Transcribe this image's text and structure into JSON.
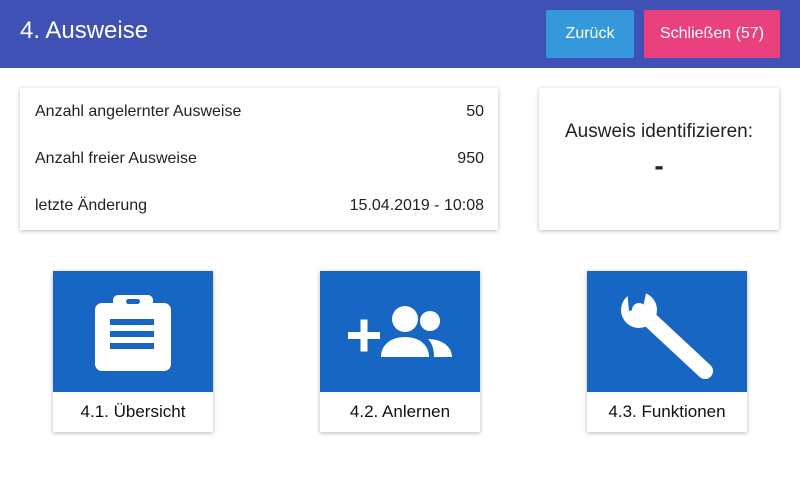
{
  "header": {
    "title": "4. Ausweise",
    "back_label": "Zurück",
    "close_label": "Schließen (57)",
    "color": "#3f51b5",
    "back_color": "#3498db",
    "close_color": "#e9407e"
  },
  "info": {
    "rows": [
      {
        "label": "Anzahl angelernter Ausweise",
        "value": "50"
      },
      {
        "label": "Anzahl freier Ausweise",
        "value": "950"
      },
      {
        "label": "letzte Änderung",
        "value": "15.04.2019 - 10:08"
      }
    ]
  },
  "identify": {
    "title": "Ausweis identifizieren:",
    "value": "-"
  },
  "tiles": [
    {
      "label": "4.1. Übersicht",
      "icon": "clipboard-icon"
    },
    {
      "label": "4.2. Anlernen",
      "icon": "add-group-icon"
    },
    {
      "label": "4.3. Funktionen",
      "icon": "wrench-icon"
    }
  ],
  "tile_color": "#1766c4"
}
